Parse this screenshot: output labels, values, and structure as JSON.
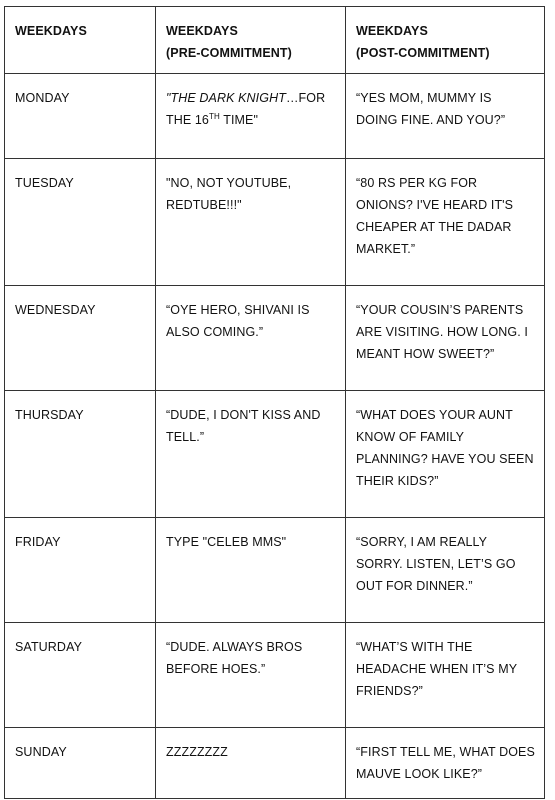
{
  "header": {
    "col1": "WEEKDAYS",
    "col2_line1": "WEEKDAYS",
    "col2_line2": "(PRE-COMMITMENT)",
    "col3_line1": "WEEKDAYS",
    "col3_line2": "(POST-COMMITMENT)"
  },
  "rows": {
    "monday": {
      "day": "MONDAY",
      "pre_italic": "\"THE DARK KNIGHT",
      "pre_rest": "…FOR THE 16",
      "pre_sup": "TH",
      "pre_end": " TIME\"",
      "post": "“YES MOM, MUMMY IS DOING FINE. AND YOU?”"
    },
    "tuesday": {
      "day": "TUESDAY",
      "pre": "\"NO, NOT YOUTUBE, REDTUBE!!!\"",
      "post": "“80 RS PER KG FOR ONIONS? I'VE HEARD IT'S CHEAPER AT THE DADAR MARKET.”"
    },
    "wednesday": {
      "day": "WEDNESDAY",
      "pre": "“OYE HERO, SHIVANI IS ALSO COMING.”",
      "post": "“YOUR COUSIN’S PARENTS ARE VISITING. HOW LONG. I MEANT HOW SWEET?”"
    },
    "thursday": {
      "day": "THURSDAY",
      "pre": "“DUDE, I DON'T KISS AND TELL.”",
      "post": "“WHAT DOES YOUR AUNT KNOW OF FAMILY PLANNING? HAVE YOU SEEN THEIR KIDS?”"
    },
    "friday": {
      "day": "FRIDAY",
      "pre": "TYPE \"CELEB MMS\"",
      "post": "“SORRY, I AM REALLY SORRY. LISTEN, LET’S GO OUT FOR DINNER.”"
    },
    "saturday": {
      "day": "SATURDAY",
      "pre": "“DUDE. ALWAYS BROS BEFORE HOES.”",
      "post": "“WHAT’S WITH THE HEADACHE WHEN IT’S MY FRIENDS?”"
    },
    "sunday": {
      "day": "SUNDAY",
      "pre": "ZZZZZZZZ",
      "post": "“FIRST TELL ME, WHAT DOES MAUVE LOOK LIKE?”"
    }
  }
}
